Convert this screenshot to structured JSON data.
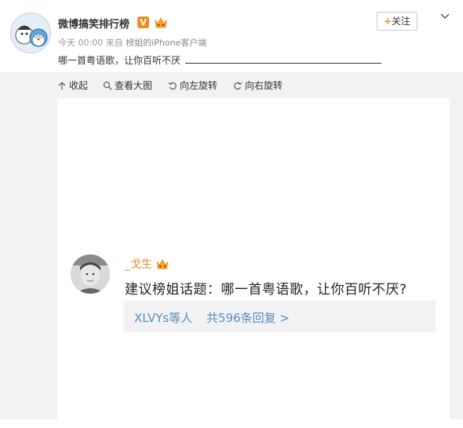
{
  "post": {
    "author": "微博搞笑排行榜",
    "verified_badge": "V",
    "timestamp": "今天 00:00",
    "source_prefix": "来自",
    "source": "榜姐的iPhone客户端",
    "text": "哪一首粤语歌，让你百听不厌",
    "follow_plus": "+",
    "follow_label": "关注"
  },
  "toolbar": {
    "collapse": "收起",
    "view_large": "查看大图",
    "rotate_left": "向左旋转",
    "rotate_right": "向右旋转"
  },
  "image_content": {
    "commenter": "_戈生",
    "comment": "建议榜姐话题：哪一首粤语歌，让你百听不厌?",
    "reply_users": "XLVYs等人",
    "reply_link": "共596条回复 >"
  },
  "colors": {
    "accent_orange": "#f08c1d",
    "link_blue": "#5a8bc1",
    "gallery_bg": "#f2f2f5"
  }
}
